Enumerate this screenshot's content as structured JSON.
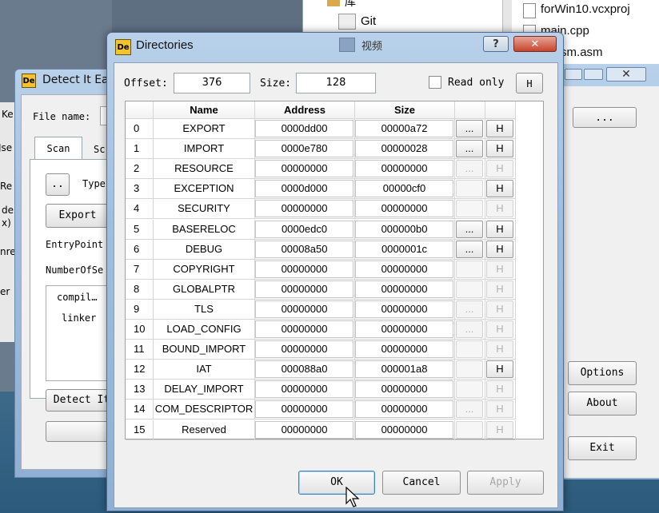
{
  "explorer": {
    "git_label": "Git",
    "top_label": "库",
    "bottom_label": "视频"
  },
  "files": [
    "forWin10.vcxproj",
    "main.cpp",
    "64asm.asm"
  ],
  "die_window": {
    "title": "Detect It Ea",
    "file_name_label": "File name:",
    "tabs": [
      "Scan",
      "Sc"
    ],
    "browse_label": "..",
    "type_label": "Type",
    "export_label": "Export",
    "entrypoint_label": "EntryPoint",
    "numberofsections_label": "NumberOfSe",
    "list": [
      "compil…",
      "linker"
    ],
    "detect_label": "Detect It",
    "left_fragments": [
      "Ke",
      "Jse",
      "Re",
      "de",
      "x)",
      "nre",
      "er"
    ]
  },
  "right_window": {
    "browse_label": "...",
    "options_label": "Options",
    "about_label": "About",
    "exit_label": "Exit"
  },
  "dialog": {
    "title": "Directories",
    "help_glyph": "?",
    "close_glyph": "✕",
    "offset_label": "Offset:",
    "offset_value": "376",
    "size_label": "Size:",
    "size_value": "128",
    "readonly_label": "Read only",
    "hex_label": "H",
    "columns": [
      "Name",
      "Address",
      "Size"
    ],
    "rows": [
      {
        "i": "0",
        "name": "EXPORT",
        "addr": "0000dd00",
        "size": "00000a72",
        "more": "on",
        "hex": "on"
      },
      {
        "i": "1",
        "name": "IMPORT",
        "addr": "0000e780",
        "size": "00000028",
        "more": "on",
        "hex": "on"
      },
      {
        "i": "2",
        "name": "RESOURCE",
        "addr": "00000000",
        "size": "00000000",
        "more": "dis",
        "hex": "dis"
      },
      {
        "i": "3",
        "name": "EXCEPTION",
        "addr": "0000d000",
        "size": "00000cf0",
        "more": "blank",
        "hex": "on"
      },
      {
        "i": "4",
        "name": "SECURITY",
        "addr": "00000000",
        "size": "00000000",
        "more": "blank",
        "hex": "dis"
      },
      {
        "i": "5",
        "name": "BASERELOC",
        "addr": "0000edc0",
        "size": "000000b0",
        "more": "on",
        "hex": "on"
      },
      {
        "i": "6",
        "name": "DEBUG",
        "addr": "00008a50",
        "size": "0000001c",
        "more": "on",
        "hex": "on"
      },
      {
        "i": "7",
        "name": "COPYRIGHT",
        "addr": "00000000",
        "size": "00000000",
        "more": "blank",
        "hex": "dis"
      },
      {
        "i": "8",
        "name": "GLOBALPTR",
        "addr": "00000000",
        "size": "00000000",
        "more": "blank",
        "hex": "dis"
      },
      {
        "i": "9",
        "name": "TLS",
        "addr": "00000000",
        "size": "00000000",
        "more": "dis",
        "hex": "dis"
      },
      {
        "i": "10",
        "name": "LOAD_CONFIG",
        "addr": "00000000",
        "size": "00000000",
        "more": "dis",
        "hex": "dis"
      },
      {
        "i": "11",
        "name": "BOUND_IMPORT",
        "addr": "00000000",
        "size": "00000000",
        "more": "blank",
        "hex": "dis"
      },
      {
        "i": "12",
        "name": "IAT",
        "addr": "000088a0",
        "size": "000001a8",
        "more": "blank",
        "hex": "on"
      },
      {
        "i": "13",
        "name": "DELAY_IMPORT",
        "addr": "00000000",
        "size": "00000000",
        "more": "blank",
        "hex": "dis"
      },
      {
        "i": "14",
        "name": "COM_DESCRIPTOR",
        "addr": "00000000",
        "size": "00000000",
        "more": "dis",
        "hex": "dis"
      },
      {
        "i": "15",
        "name": "Reserved",
        "addr": "00000000",
        "size": "00000000",
        "more": "blank",
        "hex": "dis"
      }
    ],
    "more_glyph": "...",
    "ok_label": "OK",
    "cancel_label": "Cancel",
    "apply_label": "Apply"
  }
}
